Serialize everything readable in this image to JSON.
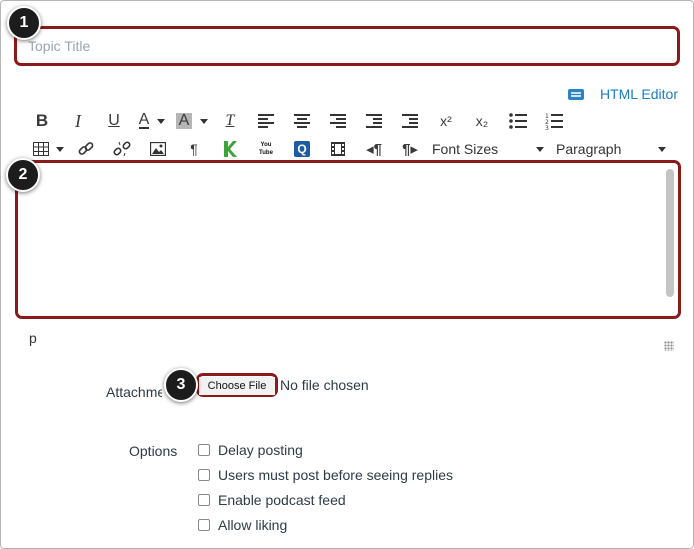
{
  "badges": [
    "1",
    "2",
    "3"
  ],
  "title": {
    "placeholder": "Topic Title",
    "value": ""
  },
  "html_editor": {
    "label": "HTML Editor",
    "icon": "keyboard-icon"
  },
  "toolbar": {
    "row1": [
      {
        "name": "bold",
        "glyph": "B"
      },
      {
        "name": "italic",
        "glyph": "I"
      },
      {
        "name": "underline",
        "glyph": "U"
      },
      {
        "name": "text-color",
        "glyph": "A"
      },
      {
        "name": "background-color",
        "glyph": "A"
      },
      {
        "name": "clear-formatting",
        "glyph": "T"
      },
      {
        "name": "align-left"
      },
      {
        "name": "align-center"
      },
      {
        "name": "align-right"
      },
      {
        "name": "outdent"
      },
      {
        "name": "indent"
      },
      {
        "name": "superscript",
        "glyph": "x²"
      },
      {
        "name": "subscript",
        "glyph": "x₂"
      },
      {
        "name": "bullet-list"
      },
      {
        "name": "numbered-list"
      }
    ],
    "font_sizes_label": "Font Sizes",
    "paragraph_label": "Paragraph",
    "youtube_label": "You Tube"
  },
  "editor": {
    "path": "p"
  },
  "attachment": {
    "label": "Attachment",
    "button": "Choose File",
    "status": "No file chosen"
  },
  "options": {
    "label": "Options",
    "items": [
      {
        "label": "Delay posting",
        "checked": false
      },
      {
        "label": "Users must post before seeing replies",
        "checked": false
      },
      {
        "label": "Enable podcast feed",
        "checked": false
      },
      {
        "label": "Allow liking",
        "checked": false
      }
    ]
  },
  "colors": {
    "highlight": "#8b1a1a",
    "link": "#1a7ec2",
    "badge": "#1c1c1c"
  }
}
